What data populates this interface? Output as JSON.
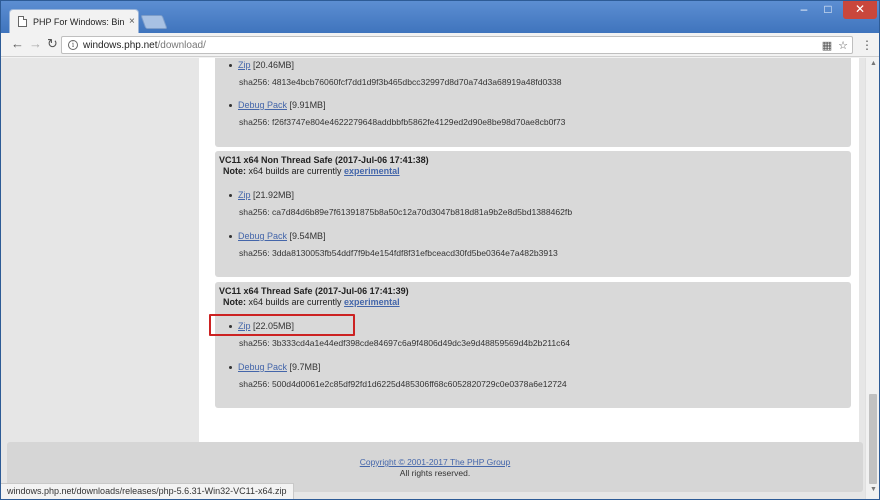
{
  "browser": {
    "tab_title": "PHP For Windows: Bin",
    "tab_close": "×",
    "url_host": "windows.php.net",
    "url_path": "/download/",
    "status_url": "windows.php.net/downloads/releases/php-5.6.31-Win32-VC11-x64.zip"
  },
  "top_partial": {
    "zip_label": "Zip",
    "zip_size": "[20.46MB]",
    "zip_sha": "sha256: 4813e4bcb76060fcf7dd1d9f3b465dbcc32997d8d70a74d3a68919a48fd0338",
    "debug_label": "Debug Pack",
    "debug_size": "[9.91MB]",
    "debug_sha": "sha256: f26f3747e804e4622279648addbbfb5862fe4129ed2d90e8be98d70ae8cb0f73"
  },
  "nts_block": {
    "title": "VC11 x64 Non Thread Safe (2017-Jul-06 17:41:38)",
    "note_label": "Note:",
    "note_text": " x64 builds are currently ",
    "note_link": "experimental",
    "zip_label": "Zip",
    "zip_size": "[21.92MB]",
    "zip_sha": "sha256: ca7d84d6b89e7f61391875b8a50c12a70d3047b818d81a9b2e8d5bd1388462fb",
    "debug_label": "Debug Pack",
    "debug_size": "[9.54MB]",
    "debug_sha": "sha256: 3dda8130053fb54ddf7f9b4e154fdf8f31efbceacd30fd5be0364e7a482b3913"
  },
  "ts_block": {
    "title": "VC11 x64 Thread Safe (2017-Jul-06 17:41:39)",
    "note_label": "Note:",
    "note_text": " x64 builds are currently ",
    "note_link": "experimental",
    "zip_label": "Zip",
    "zip_size": "[22.05MB]",
    "zip_sha": "sha256: 3b333cd4a1e44edf398cde84697c6a9f4806d49dc3e9d48859569d4b2b211c64",
    "debug_label": "Debug Pack",
    "debug_size": "[9.7MB]",
    "debug_sha": "sha256: 500d4d0061e2c85df92fd1d6225d485306ff68c6052820729c0e0378a6e12724"
  },
  "footer": {
    "copyright": "Copyright © 2001-2017 The PHP Group",
    "rights": "All rights reserved."
  },
  "colors": {
    "link": "#4466aa",
    "highlight_box": "#cc2222",
    "block_bg": "#d9d9d9"
  }
}
